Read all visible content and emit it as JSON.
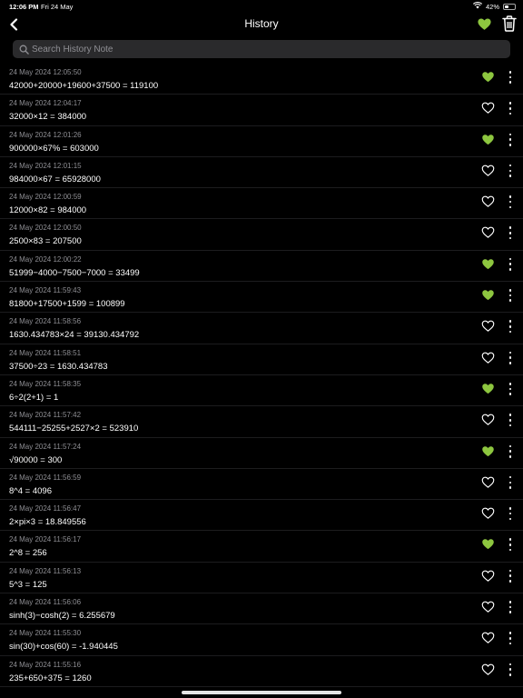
{
  "status_bar": {
    "time": "12:06 PM",
    "date": "Fri 24 May",
    "battery": "42%"
  },
  "nav": {
    "title": "History"
  },
  "search": {
    "placeholder": "Search History Note"
  },
  "colors": {
    "accent": "#8dc63f",
    "background": "#000000",
    "secondary_text": "#8e8e93"
  },
  "history": [
    {
      "timestamp": "24 May 2024 12:05:50",
      "expression": "42000+20000+19600+37500 = 119100",
      "favorite": true
    },
    {
      "timestamp": "24 May 2024 12:04:17",
      "expression": "32000×12 = 384000",
      "favorite": false
    },
    {
      "timestamp": "24 May 2024 12:01:26",
      "expression": "900000×67% = 603000",
      "favorite": true
    },
    {
      "timestamp": "24 May 2024 12:01:15",
      "expression": "984000×67 = 65928000",
      "favorite": false
    },
    {
      "timestamp": "24 May 2024 12:00:59",
      "expression": "12000×82 = 984000",
      "favorite": false
    },
    {
      "timestamp": "24 May 2024 12:00:50",
      "expression": "2500×83 = 207500",
      "favorite": false
    },
    {
      "timestamp": "24 May 2024 12:00:22",
      "expression": "51999−4000−7500−7000 = 33499",
      "favorite": true
    },
    {
      "timestamp": "24 May 2024 11:59:43",
      "expression": "81800+17500+1599 = 100899",
      "favorite": true
    },
    {
      "timestamp": "24 May 2024 11:58:56",
      "expression": "1630.434783×24 = 39130.434792",
      "favorite": false
    },
    {
      "timestamp": "24 May 2024 11:58:51",
      "expression": "37500÷23 = 1630.434783",
      "favorite": false
    },
    {
      "timestamp": "24 May 2024 11:58:35",
      "expression": "6÷2(2+1) = 1",
      "favorite": true
    },
    {
      "timestamp": "24 May 2024 11:57:42",
      "expression": "544111−25255+2527×2 = 523910",
      "favorite": false
    },
    {
      "timestamp": "24 May 2024 11:57:24",
      "expression": "√90000 = 300",
      "favorite": true
    },
    {
      "timestamp": "24 May 2024 11:56:59",
      "expression": "8^4 = 4096",
      "favorite": false
    },
    {
      "timestamp": "24 May 2024 11:56:47",
      "expression": "2×pi×3 = 18.849556",
      "favorite": false
    },
    {
      "timestamp": "24 May 2024 11:56:17",
      "expression": "2^8 = 256",
      "favorite": true
    },
    {
      "timestamp": "24 May 2024 11:56:13",
      "expression": "5^3 = 125",
      "favorite": false
    },
    {
      "timestamp": "24 May 2024 11:56:06",
      "expression": "sinh(3)−cosh(2) = 6.255679",
      "favorite": false
    },
    {
      "timestamp": "24 May 2024 11:55:30",
      "expression": "sin(30)+cos(60) = -1.940445",
      "favorite": false
    },
    {
      "timestamp": "24 May 2024 11:55:16",
      "expression": "235+650+375 = 1260",
      "favorite": false
    }
  ]
}
